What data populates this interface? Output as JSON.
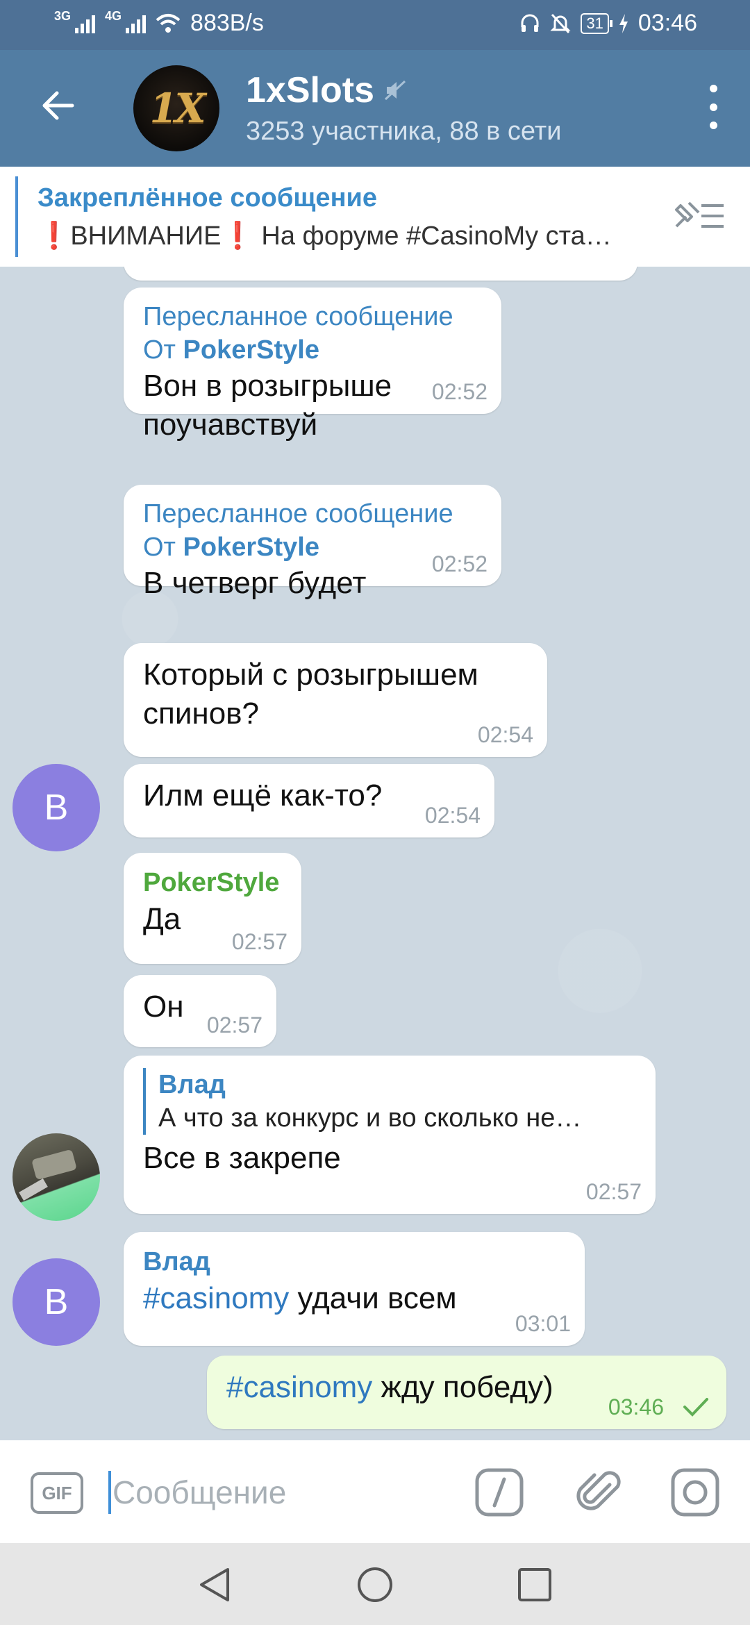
{
  "status_bar": {
    "network_left": "3G",
    "network_right": "4G",
    "speed": "883B/s",
    "battery": "31",
    "time": "03:46",
    "icons": [
      "signal-icon",
      "wifi-icon",
      "headset-icon",
      "mute-bell-icon",
      "battery-icon",
      "charging-icon"
    ]
  },
  "header": {
    "back_icon": "arrow-left-icon",
    "avatar_text": "1X",
    "title": "1xSlots",
    "subtitle": "3253 участника, 88 в сети",
    "muted_icon": "speaker-mute-icon",
    "menu_icon": "more-vert-icon"
  },
  "pinned": {
    "title": "Закреплённое сообщение",
    "excl": "❗",
    "text_before": "ВНИМАНИЕ",
    "text_after": "На форуме #CasinoMy ста…",
    "icon": "pin-list-icon"
  },
  "messages": [
    {
      "forward_label": "Пересланное сообщение",
      "from_prefix": "От",
      "from": "PokerStyle",
      "text": "Вон в розыгрыше поучавствуй",
      "time": "02:52"
    },
    {
      "forward_label": "Пересланное сообщение",
      "from_prefix": "От",
      "from": "PokerStyle",
      "text": "В четверг будет",
      "time": "02:52"
    },
    {
      "text": "Который с розыгрышем спинов?",
      "time": "02:54"
    },
    {
      "text": "Илм ещё как-то?",
      "time": "02:54",
      "avatar": "В"
    },
    {
      "sender": "PokerStyle",
      "text": "Да",
      "time": "02:57"
    },
    {
      "text": "Он",
      "time": "02:57"
    },
    {
      "reply_name": "Влад",
      "reply_text": "А что за конкурс и во сколько не…",
      "text": "Все в закрепе",
      "time": "02:57"
    },
    {
      "sender": "Влад",
      "hashtag": "#casinomy",
      "text": "удачи всем",
      "time": "03:01",
      "avatar": "В"
    },
    {
      "hashtag": "#casinomy",
      "text": "жду победу)",
      "time": "03:46",
      "outgoing": true
    }
  ],
  "input": {
    "gif_label": "GIF",
    "placeholder": "Сообщение",
    "icons": [
      "bot-command-icon",
      "paperclip-icon",
      "camera-icon"
    ]
  },
  "nav": {
    "icons": [
      "nav-back-icon",
      "nav-home-icon",
      "nav-recents-icon"
    ]
  },
  "colors": {
    "header": "#527da3",
    "status": "#4e7196",
    "link": "#3c86c2",
    "sender_green": "#4fa83d",
    "outgoing": "#effdde",
    "avatar": "#8b7fe0"
  }
}
